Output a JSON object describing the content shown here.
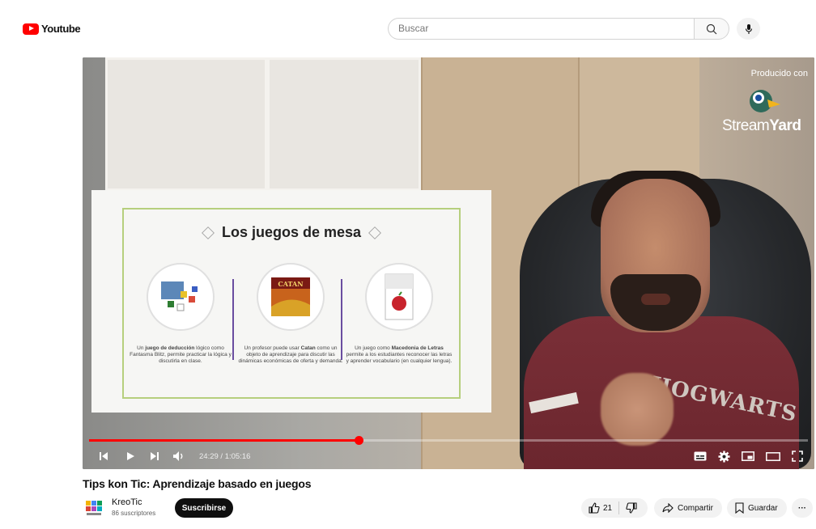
{
  "header": {
    "logo_text": "Youtube",
    "search_placeholder": "Buscar"
  },
  "player": {
    "watermark_top": "Producido con",
    "watermark_brand_a": "Stream",
    "watermark_brand_b": "Yard",
    "shirt_text": "HOGWARTS",
    "time_display": "24:29 / 1:05:16",
    "progress_fraction": 0.375
  },
  "slide": {
    "title": "Los juegos de mesa",
    "games": [
      {
        "desc_pre": "Un ",
        "desc_bold": "juego de deducción",
        "desc_post": " lógico como Fantasma Blitz, permite practicar la lógica y discutirla en clase."
      },
      {
        "desc_pre": "Un profesor puede usar ",
        "desc_bold": "Catan",
        "desc_post": " como un objeto de aprendizaje para discutir las dinámicas económicas de oferta y demanda."
      },
      {
        "desc_pre": "Un juego como ",
        "desc_bold": "Macedonia de Letras",
        "desc_post": " permite a los estudiantes reconocer las letras y aprender vocabulario (en cualquier lengua)."
      }
    ],
    "catan_label": "CATAN"
  },
  "video": {
    "title": "Tips kon Tic: Aprendizaje basado en juegos",
    "channel_name": "KreoTic",
    "subscribers": "86 suscriptores",
    "subscribe_label": "Suscribirse",
    "likes": "21",
    "share_label": "Compartir",
    "save_label": "Guardar",
    "more_label": "···"
  }
}
